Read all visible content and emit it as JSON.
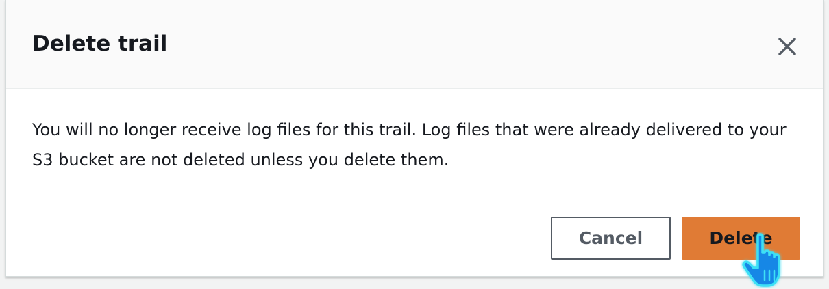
{
  "dialog": {
    "title": "Delete trail",
    "close_label": "Close",
    "message": "You will no longer receive log files for this trail. Log files that were already delivered to your S3 bucket are not deleted unless you delete them.",
    "buttons": {
      "cancel_label": "Cancel",
      "delete_label": "Delete"
    }
  },
  "icons": {
    "close": "close-icon",
    "cursor": "hand-pointer-icon"
  },
  "colors": {
    "primary_button": "#e07b35",
    "text": "#16191f",
    "secondary_border": "#545b64",
    "cursor_fill": "#1487e6",
    "cursor_glow": "#3ee0f5"
  }
}
